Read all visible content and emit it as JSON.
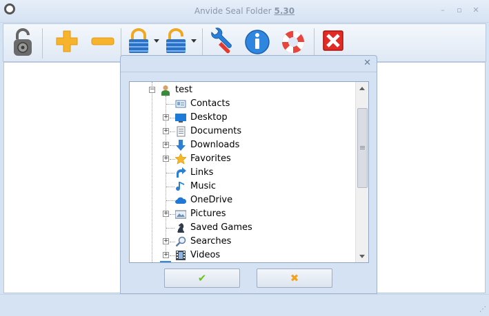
{
  "window": {
    "title": "Anvide Seal Folder",
    "version": "5.30",
    "controls": {
      "minimize": "–",
      "restore": "▫",
      "close": "✕"
    }
  },
  "toolbar": {
    "buttons": [
      {
        "name": "lock-status",
        "icon": "padlock-dial-icon"
      },
      {
        "name": "add-folder",
        "icon": "plus-icon"
      },
      {
        "name": "remove-folder",
        "icon": "minus-icon"
      },
      {
        "name": "lock-folder",
        "icon": "lock-closed-icon",
        "dropdown": true
      },
      {
        "name": "unlock-folder",
        "icon": "lock-open-icon",
        "dropdown": true
      },
      {
        "name": "settings",
        "icon": "wrench-icon"
      },
      {
        "name": "about",
        "icon": "info-icon"
      },
      {
        "name": "help",
        "icon": "lifebuoy-icon"
      },
      {
        "name": "exit",
        "icon": "close-square-icon"
      }
    ]
  },
  "dialog": {
    "close_glyph": "✕",
    "tree": {
      "root": {
        "label": "test",
        "expander": "−",
        "icon": "user-icon"
      },
      "items": [
        {
          "label": "Contacts",
          "expandable": false,
          "icon": "contacts-icon"
        },
        {
          "label": "Desktop",
          "expandable": true,
          "icon": "desktop-icon"
        },
        {
          "label": "Documents",
          "expandable": true,
          "icon": "documents-icon"
        },
        {
          "label": "Downloads",
          "expandable": true,
          "icon": "download-arrow-icon"
        },
        {
          "label": "Favorites",
          "expandable": true,
          "icon": "star-icon"
        },
        {
          "label": "Links",
          "expandable": false,
          "icon": "link-arrow-icon"
        },
        {
          "label": "Music",
          "expandable": false,
          "icon": "music-note-icon"
        },
        {
          "label": "OneDrive",
          "expandable": false,
          "icon": "cloud-icon"
        },
        {
          "label": "Pictures",
          "expandable": true,
          "icon": "pictures-icon"
        },
        {
          "label": "Saved Games",
          "expandable": false,
          "icon": "chess-knight-icon"
        },
        {
          "label": "Searches",
          "expandable": true,
          "icon": "magnifier-icon"
        },
        {
          "label": "Videos",
          "expandable": true,
          "icon": "film-icon"
        }
      ],
      "expander_plus": "+"
    },
    "ok_glyph": "✔",
    "cancel_glyph": "✖",
    "colors": {
      "ok": "#6fbf1f",
      "cancel": "#f3a31a"
    }
  }
}
